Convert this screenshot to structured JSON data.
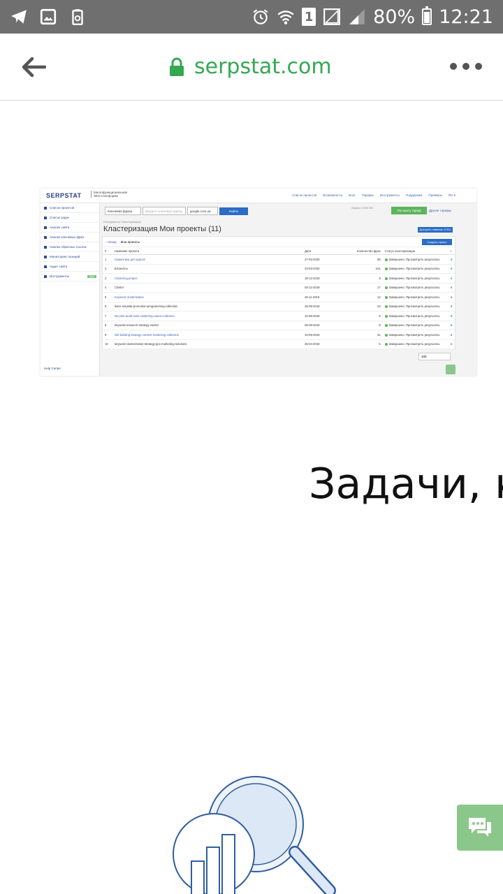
{
  "status_bar": {
    "battery": "80%",
    "time": "12:21",
    "sim": "1",
    "icons": [
      "telegram-icon",
      "gallery-icon",
      "recycle-icon",
      "alarm-icon",
      "wifi-icon",
      "sim-icon",
      "signal-icon",
      "signal-icon",
      "battery-icon"
    ]
  },
  "browser": {
    "url": "serpstat.com",
    "back_icon": "arrow-left-icon",
    "lock_icon": "lock-icon",
    "menu_icon": "more-horizontal-icon",
    "url_color": "#33a852"
  },
  "shot": {
    "logo": "SERPSTAT",
    "logo_sub": "Многофункциональная SEO-платформа",
    "top_nav": [
      "Список проектов",
      "Возможности",
      "Блог",
      "Тарифы",
      "Инструменты",
      "Поддержка",
      "Примеры",
      "RU ▾"
    ],
    "sidebar": [
      {
        "label": "Список проектов"
      },
      {
        "label": "Список задач"
      },
      {
        "label": "Анализ сайта"
      },
      {
        "label": "Анализ ключевых фраз"
      },
      {
        "label": "Анализ обратных ссылок"
      },
      {
        "label": "Мониторинг позиций"
      },
      {
        "label": "Аудит сайта"
      },
      {
        "label": "Инструменты",
        "badge": "New"
      }
    ],
    "help": "Help Center",
    "search": {
      "mode": "Ключевая фраза",
      "placeholder": "введите ключевую фразу",
      "engine": "google.com.ua",
      "button": "Найти"
    },
    "limits": "Лимиты: 8 000 000",
    "upgrade_button": "Улучшить тариф",
    "other_plans": "Другие тарифы",
    "breadcrumb": "Инструменты / Кластеризация",
    "page_title": "Кластеризация Мои проекты (11)",
    "available": "Доступно лимитов: 8 914",
    "back_link": "‹ Назад",
    "my_projects": "Мои проекты",
    "create_button": "Создать проект",
    "columns": [
      "#",
      "Название проекта",
      "Дата",
      "Количество фраз",
      "Статус кластеризации",
      ""
    ],
    "rows": [
      {
        "n": "1",
        "name": "Семантика для курсов",
        "date": "27-03-2020",
        "count": "96",
        "status": "Завершено. Просмотреть результаты",
        "blue": true
      },
      {
        "n": "2",
        "name": "Блокноты",
        "date": "23-03-2020",
        "count": "101",
        "status": "Завершено. Просмотреть результаты",
        "blue": false
      },
      {
        "n": "3",
        "name": "Clustering project",
        "date": "18-12-2019",
        "count": "8",
        "status": "Завершено. Просмотреть результаты",
        "blue": true
      },
      {
        "n": "4",
        "name": "Cluster",
        "date": "03-12-2019",
        "count": "17",
        "status": "Завершено. Просмотреть результаты",
        "blue": false
      },
      {
        "n": "5",
        "name": "Keyword clusterization",
        "date": "26-11-2019",
        "count": "14",
        "status": "Завершено. Просмотреть результаты",
        "blue": true
      },
      {
        "n": "6",
        "name": "learn-serpstat-promotion-programming-collection",
        "date": "25-09-2019",
        "count": "23",
        "status": "Завершено. Просмотреть результаты",
        "blue": false
      },
      {
        "n": "7",
        "name": "seo-site-audit-tools-clustering-cases-collection",
        "date": "10-09-2019",
        "count": "6",
        "status": "Завершено. Просмотреть результаты",
        "blue": true
      },
      {
        "n": "8",
        "name": "keyword-research-strategy-cluster",
        "date": "05-09-2019",
        "count": "8",
        "status": "Завершено. Просмотреть результаты",
        "blue": false
      },
      {
        "n": "9",
        "name": "link-building-strategy-content-marketing-collection",
        "date": "10-05-2019",
        "count": "31",
        "status": "Завершено. Просмотреть результаты",
        "blue": true
      },
      {
        "n": "10",
        "name": "keyword-clusterization-strategy-ppc-marketing-solutions",
        "date": "25-04-2019",
        "count": "5",
        "status": "Завершено. Просмотреть результаты",
        "blue": false
      }
    ],
    "per_page": "100"
  },
  "headline": "Задачи, к",
  "chat_icon": "chat-bubbles-icon",
  "illustration_icon": "magnifier-chart-icon"
}
